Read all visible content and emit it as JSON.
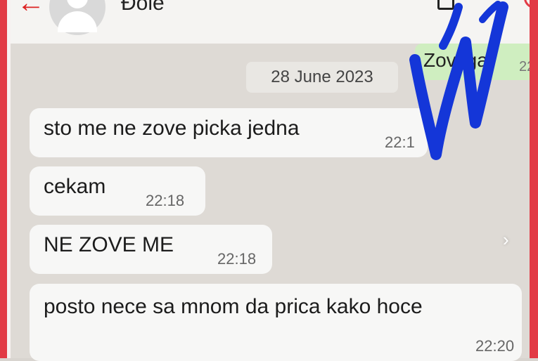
{
  "header": {
    "back_glyph": "←",
    "contact_name": "Đole"
  },
  "date_separator": "28 June 2023",
  "outgoing_message": {
    "text": "Zovi ga",
    "time": "22"
  },
  "messages": [
    {
      "text": "sto me ne zove picka jedna",
      "time": "22:1"
    },
    {
      "text": "cekam",
      "time": "22:18"
    },
    {
      "text": "NE ZOVE ME",
      "time": "22:18"
    },
    {
      "text": "posto nece sa mnom da prica kako hoce",
      "time": "22:20"
    }
  ],
  "colors": {
    "frame": "#e23a45",
    "scribble": "#1436d8",
    "incoming_bubble": "#f7f7f6",
    "outgoing_bubble": "#cfeec0",
    "chat_background": "#dedad5"
  },
  "icons": [
    "back-arrow-icon",
    "avatar-icon",
    "call-icon",
    "menu-icon",
    "chevron-right-icon"
  ]
}
